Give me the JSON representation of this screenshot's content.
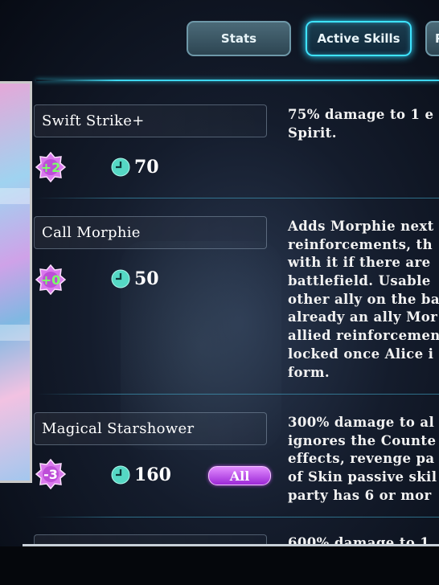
{
  "tabs": [
    {
      "label": "Stats",
      "active": false
    },
    {
      "label": "Active Skills",
      "active": true
    },
    {
      "label": "P",
      "active": false
    }
  ],
  "skills": [
    {
      "name": "Swift Strike+",
      "cost": "+2",
      "cooldown": "70",
      "target": "",
      "description": [
        "75% damage to 1 e",
        "Spirit."
      ]
    },
    {
      "name": "Call Morphie",
      "cost": "+0",
      "cooldown": "50",
      "target": "",
      "description": [
        "Adds Morphie next",
        "reinforcements, th",
        "with it if there are",
        "battlefield. Usable",
        "other ally on the ba",
        "already an ally Mor",
        "allied reinforcemen",
        "locked once Alice i",
        "form."
      ]
    },
    {
      "name": "Magical Starshower",
      "cost": "-3",
      "cooldown": "160",
      "target": "All",
      "description": [
        "300% damage to al",
        "ignores the Counte",
        "effects, revenge pa",
        "of Skin passive skil",
        "party has 6 or mor"
      ]
    },
    {
      "name": "",
      "cost": "",
      "cooldown": "",
      "target": "",
      "description": [
        "600% damage to 1"
      ]
    }
  ],
  "colors": {
    "accent": "#3ee4ff",
    "gem": "#e08cf0",
    "badge": "#b040e0",
    "clock": "#5fe0c8"
  }
}
